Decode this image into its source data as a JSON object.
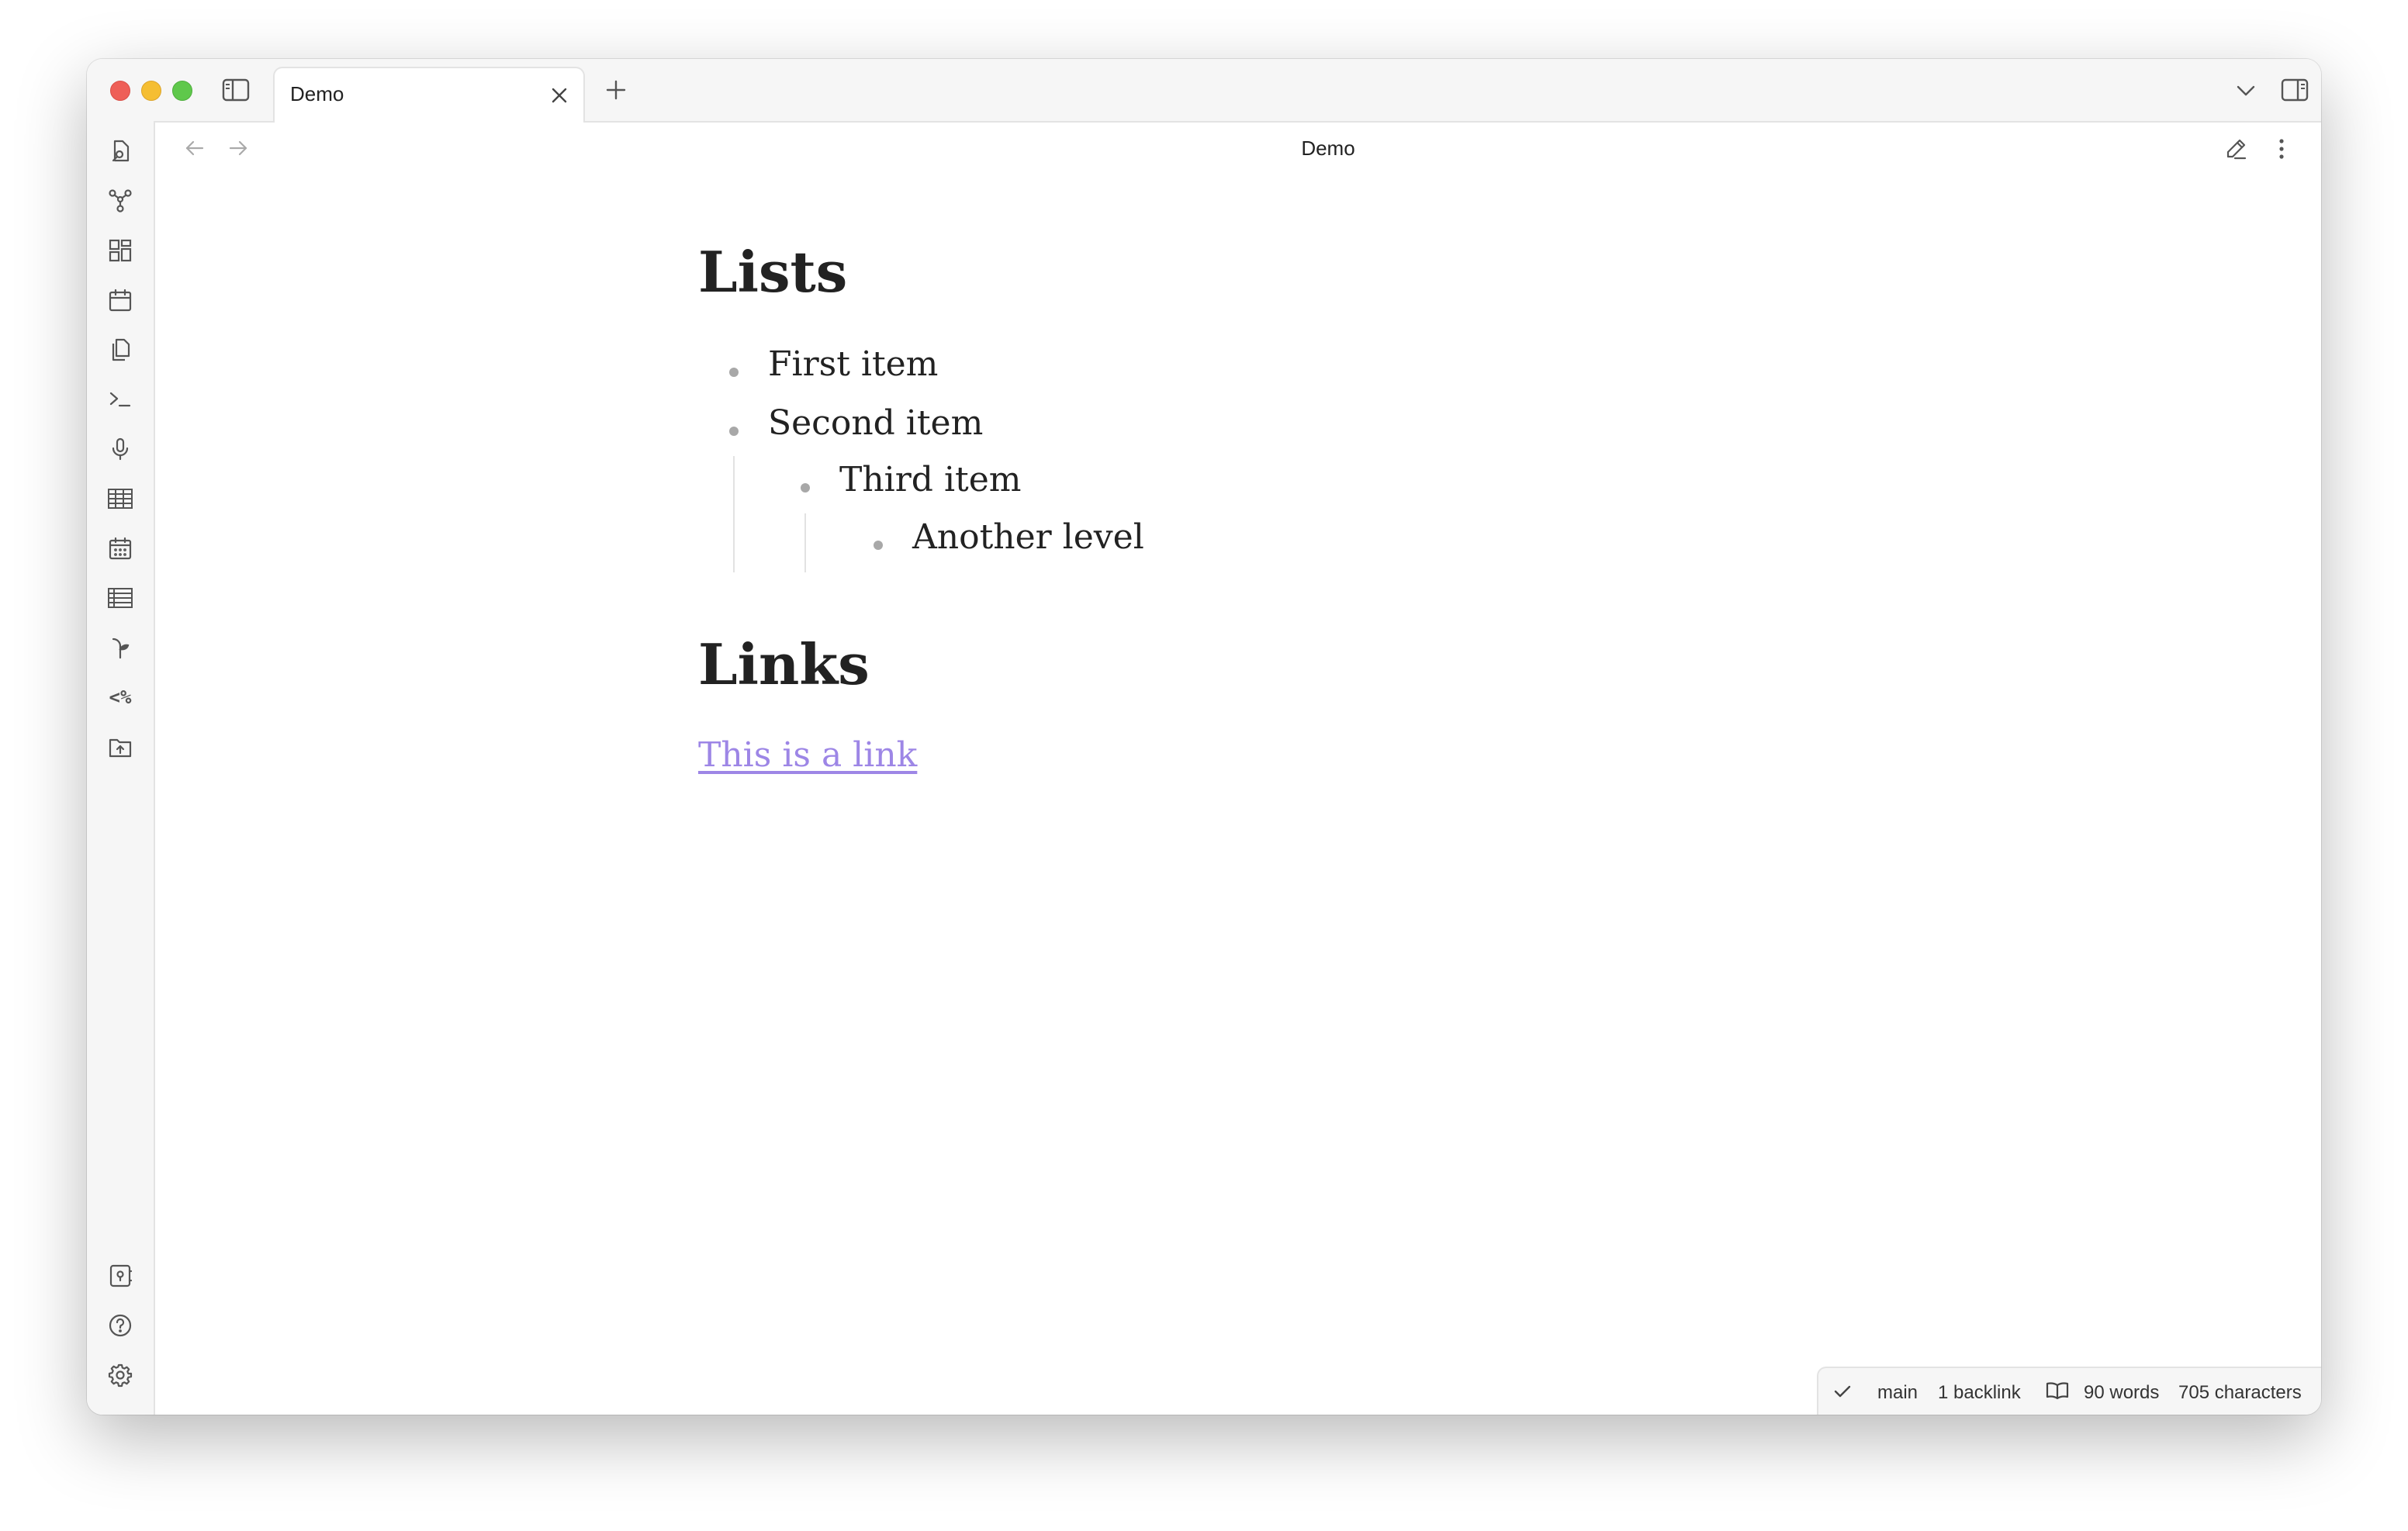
{
  "tab": {
    "title": "Demo"
  },
  "view": {
    "title": "Demo"
  },
  "ribbon": {
    "top_icons": [
      "open-quick-switcher-icon",
      "graph-view-icon",
      "canvas-icon",
      "daily-note-icon",
      "templates-icon",
      "command-palette-icon",
      "audio-recorder-icon",
      "table-icon",
      "calendar-icon",
      "spreadsheet-icon",
      "sprout-icon",
      "templater-icon",
      "upload-folder-icon"
    ],
    "bottom_icons": [
      "vault-switcher-icon",
      "help-icon",
      "settings-icon"
    ]
  },
  "document": {
    "lists_heading": "Lists",
    "list_items": [
      "First item",
      "Second item",
      "Third item",
      "Another level"
    ],
    "links_heading": "Links",
    "link_text": "This is a link"
  },
  "statusbar": {
    "branch": "main",
    "backlinks": "1 backlink",
    "words": "90 words",
    "characters": "705 characters"
  },
  "colors": {
    "link": "#9d86e6",
    "bullet": "#a8a8a8",
    "chrome_bg": "#f6f6f6"
  }
}
